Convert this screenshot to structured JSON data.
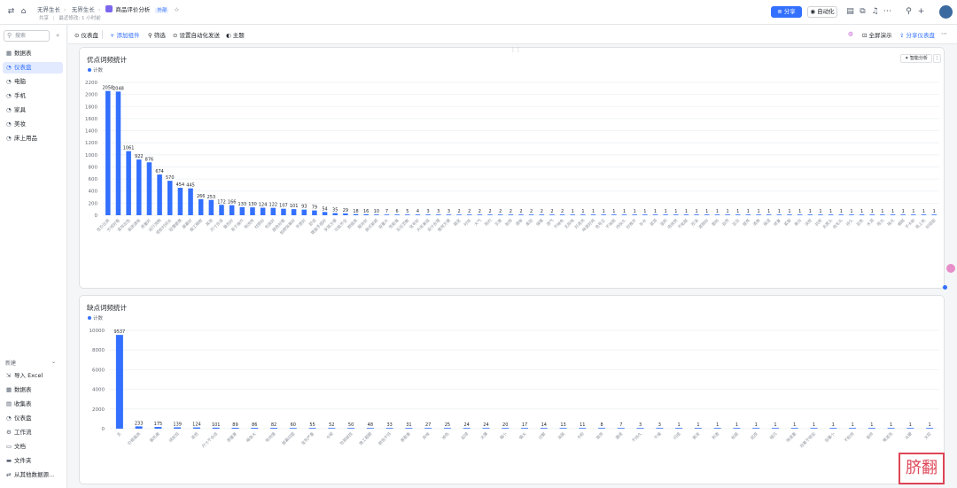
{
  "topbar": {
    "breadcrumbs": [
      "无界生长",
      "无界生长"
    ],
    "doc_title": "商品评价分析",
    "doc_tag": "外部",
    "star": "☆",
    "share_label": "共享",
    "edit_info": "最近修改: 1 小时前",
    "share_button": "分享",
    "automation_button": "自动化"
  },
  "sidebar": {
    "search_placeholder": "搜索",
    "items": [
      {
        "label": "数据表",
        "icon": "table-icon"
      },
      {
        "label": "仪表盘",
        "icon": "dashboard-icon"
      },
      {
        "label": "电脑",
        "icon": "dashboard-icon"
      },
      {
        "label": "手机",
        "icon": "dashboard-icon"
      },
      {
        "label": "家具",
        "icon": "dashboard-icon"
      },
      {
        "label": "美妆",
        "icon": "dashboard-icon"
      },
      {
        "label": "床上用品",
        "icon": "dashboard-icon"
      }
    ],
    "new_heading": "新建",
    "new_items": [
      {
        "label": "导入 Excel",
        "icon": "excel-icon"
      },
      {
        "label": "数据表",
        "icon": "table-icon"
      },
      {
        "label": "收集表",
        "icon": "form-icon"
      },
      {
        "label": "仪表盘",
        "icon": "dashboard-icon"
      },
      {
        "label": "工作流",
        "icon": "workflow-icon"
      },
      {
        "label": "文档",
        "icon": "doc-icon"
      },
      {
        "label": "文件夹",
        "icon": "folder-icon"
      },
      {
        "label": "从其他数据源...",
        "icon": "datasource-icon"
      }
    ]
  },
  "toolbar": {
    "dashboard_label": "仪表盘",
    "add_component": "添加组件",
    "filter": "筛选",
    "schedule": "设置自动化发送",
    "theme": "主题",
    "fullscreen": "全屏演示",
    "share_dashboard": "分享仪表盘"
  },
  "colors": {
    "accent": "#3370ff",
    "bar": "#3370ff",
    "grid": "#eef0f2"
  },
  "chart_data": [
    {
      "type": "bar",
      "title": "优点词频统计",
      "legend": "计数",
      "smart_analysis": "智能分析",
      "ylim": [
        0,
        2200
      ],
      "yticks": [
        0,
        200,
        400,
        600,
        800,
        1000,
        1200,
        1400,
        1600,
        1800,
        2000,
        2200
      ],
      "grid": true,
      "categories": [
        "性价比高",
        "外观好看",
        "音效出色",
        "画质清晰",
        "质量好",
        "运行流畅",
        "续航时间长",
        "轻薄便携",
        "屏幕好",
        "做工精致",
        "其他",
        "尺寸合适",
        "散热好",
        "易于操作",
        "物流快",
        "材质好",
        "包装好",
        "颜色好看",
        "拍照效果好",
        "手感好",
        "舒适",
        "键盘手感好",
        "安装方便",
        "功能齐全",
        "颜值高",
        "服务好",
        "款式新颖",
        "容量大",
        "性能强",
        "反应灵敏",
        "信号好",
        "外形美观",
        "设计合理",
        "使用方便",
        "稳定",
        "时尚",
        "大气",
        "简约",
        "实惠",
        "耐用",
        "清晰",
        "柔软",
        "保暖",
        "透气",
        "不掉色",
        "无异味",
        "好清洗",
        "味道好闻",
        "色号正",
        "不油腻",
        "持妆久",
        "好推开",
        "补水",
        "滋润",
        "温和",
        "吸收快",
        "不粘腻",
        "控油",
        "遮瑕好",
        "服帖",
        "自然",
        "显白",
        "提亮",
        "清爽",
        "保湿",
        "修复",
        "紧致",
        "美白",
        "淡斑",
        "抗老",
        "去黑头",
        "收毛孔",
        "持久",
        "显色",
        "水润",
        "哑光",
        "珠光",
        "细腻",
        "不卡粉",
        "易上色",
        "好搭配"
      ],
      "values": [
        2058,
        2048,
        1061,
        922,
        876,
        674,
        570,
        454,
        445,
        266,
        253,
        172,
        166,
        133,
        130,
        124,
        122,
        107,
        101,
        93,
        79,
        54,
        35,
        29,
        18,
        16,
        10,
        7,
        6,
        5,
        4,
        3,
        3,
        3,
        2,
        2,
        2,
        2,
        2,
        2,
        2,
        2,
        2,
        2,
        2,
        1,
        1,
        1,
        1,
        1,
        1,
        1,
        1,
        1,
        1,
        1,
        1,
        1,
        1,
        1,
        1,
        1,
        1,
        1,
        1,
        1,
        1,
        1,
        1,
        1,
        1,
        1,
        1,
        1,
        1,
        1,
        1,
        1,
        1,
        1,
        1
      ]
    },
    {
      "type": "bar",
      "title": "缺点词频统计",
      "legend": "计数",
      "ylim": [
        0,
        10000
      ],
      "yticks": [
        0,
        2000,
        4000,
        6000,
        8000,
        10000
      ],
      "grid": true,
      "categories": [
        "无",
        "价格偏高",
        "散热差",
        "续航短",
        "其他",
        "尺寸不合适",
        "质量差",
        "噪音大",
        "物流慢",
        "屏幕问题",
        "发热严重",
        "卡顿",
        "包装破损",
        "做工粗糙",
        "颜色不符",
        "客服差",
        "异味",
        "掉色",
        "起球",
        "太薄",
        "偏小",
        "偏大",
        "过敏",
        "油腻",
        "卡粉",
        "假货",
        "漏液",
        "不持久",
        "干燥",
        "闷痘",
        "脱妆",
        "刺激",
        "粘腻",
        "起皮",
        "暗沉",
        "味道重",
        "效果不明显",
        "容量小",
        "不耐用",
        "易碎",
        "难清洗",
        "太硬",
        "太软"
      ],
      "values": [
        9537,
        233,
        175,
        139,
        124,
        101,
        89,
        86,
        82,
        60,
        55,
        52,
        50,
        48,
        33,
        31,
        27,
        25,
        24,
        24,
        20,
        17,
        14,
        13,
        11,
        8,
        7,
        3,
        3,
        1,
        1,
        1,
        1,
        1,
        1,
        1,
        1,
        1,
        1,
        1,
        1,
        1,
        1
      ]
    }
  ],
  "watermark": "脐翻"
}
